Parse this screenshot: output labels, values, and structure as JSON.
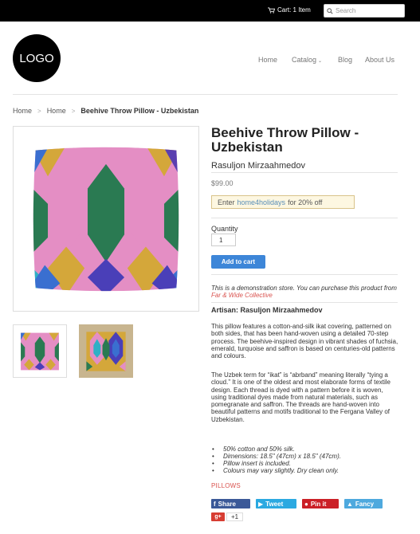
{
  "topbar": {
    "cart_label": "Cart: 1 Item",
    "search_placeholder": "Search"
  },
  "header": {
    "logo_text": "LOGO",
    "nav": [
      {
        "label": "Home"
      },
      {
        "label": "Catalog"
      },
      {
        "label": "Blog"
      },
      {
        "label": "About Us"
      }
    ]
  },
  "breadcrumb": {
    "items": [
      "Home",
      "Home",
      "Beehive Throw Pillow - Uzbekistan"
    ],
    "separator": ">"
  },
  "product": {
    "title": "Beehive Throw Pillow - Uzbekistan",
    "vendor": "Rasuljon Mirzaahmedov",
    "price": "$99.00",
    "promo": {
      "prefix": "Enter",
      "code": "home4holidays",
      "suffix": "for 20% off"
    },
    "quantity_label": "Quantity",
    "quantity_value": "1",
    "add_to_cart": "Add to cart",
    "demo_text": "This is a demonstration store. You can purchase this product from",
    "demo_link": "Far & Wide Collective",
    "artisan": "Artisan: Rasuljon Mirzaahmedov",
    "description": [
      "This pillow features a cotton-and-silk ikat covering, patterned on both sides, that has been hand-woven using a detailed 70-step process. The beehive-inspired design in vibrant shades of fuchsia, emerald, turquoise and saffron is based on centuries-old patterns and colours.",
      "The Uzbek term for “ikat” is “abrband” meaning literally “tying a cloud.” It is one of the oldest and most elaborate forms of textile design. Each thread is dyed with a pattern before it is woven, using traditional dyes made from natural materials, such as pomegranate and saffron. The threads are hand-woven into beautiful patterns and motifs traditional to the Fergana Valley of Uzbekistan."
    ],
    "bullets": [
      " 50% cotton and 50% silk.",
      "Dimensions: 18.5\" (47cm) x 18.5\" (47cm).",
      "Pillow insert is included.",
      "Colours may vary slightly. Dry clean only."
    ],
    "tag": "PILLOWS"
  },
  "social": {
    "facebook": "Share",
    "twitter": "Tweet",
    "pinterest": "Pin it",
    "fancy": "Fancy",
    "gplus_count": "+1",
    "colors": {
      "facebook": "#3b5998",
      "twitter": "#2ba9e1",
      "pinterest": "#cb2027",
      "fancy": "#4ea9de",
      "gplus": "#d73d32"
    }
  },
  "colors": {
    "accent": "#3d86d8",
    "link": "#d9534f",
    "topbar": "#000000"
  }
}
